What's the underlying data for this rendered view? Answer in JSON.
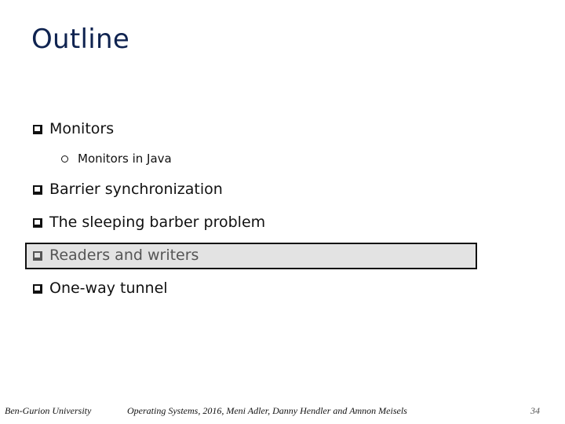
{
  "slide": {
    "title": "Outline",
    "items": [
      {
        "label": "Monitors",
        "subitems": [
          "Monitors in Java"
        ]
      },
      {
        "label": "Barrier synchronization"
      },
      {
        "label": "The sleeping barber problem"
      },
      {
        "label": "Readers and writers",
        "highlighted": true
      },
      {
        "label": "One-way tunnel"
      }
    ]
  },
  "footer": {
    "left": "Ben-Gurion University",
    "center": "Operating Systems, 2016, Meni Adler, Danny Hendler and Amnon Meisels",
    "page_number": "34"
  }
}
